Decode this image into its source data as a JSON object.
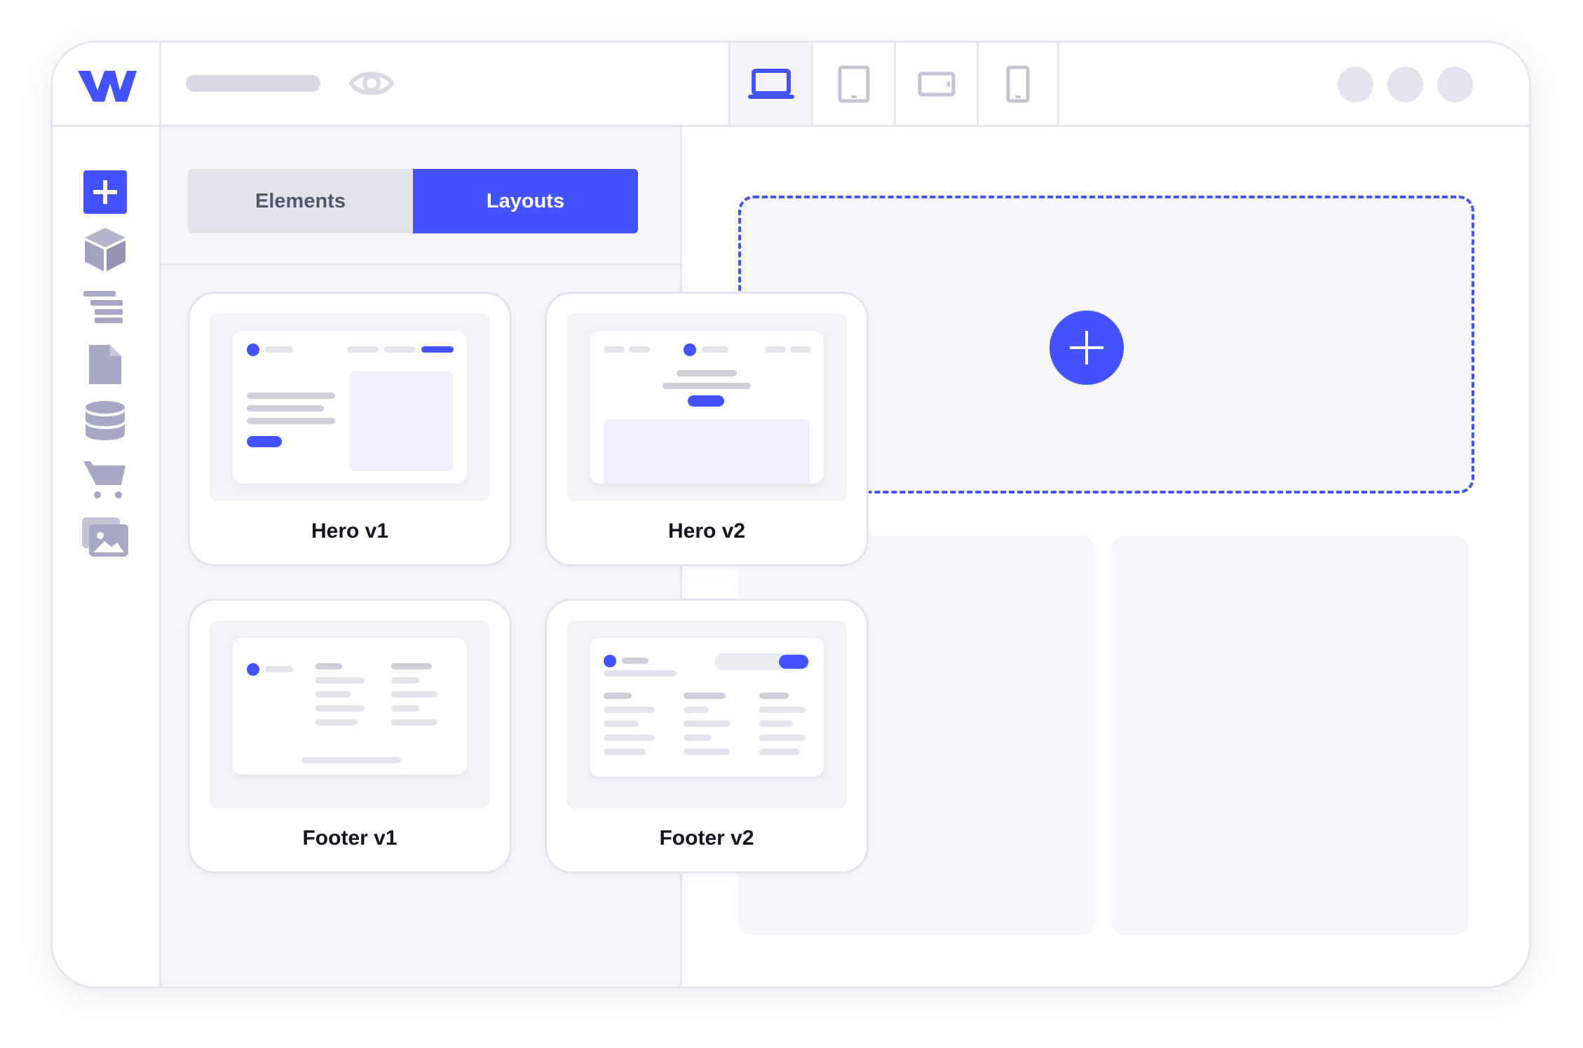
{
  "colors": {
    "accent": "#4353ff",
    "icon_gray": "#a8a8c4",
    "border": "#e6e6ee",
    "panel_bg": "#f6f6fa"
  },
  "topbar": {
    "logo_icon": "webflow-logo",
    "preview_icon": "eye-icon",
    "devices": [
      {
        "icon": "laptop-icon",
        "active": true
      },
      {
        "icon": "tablet-icon",
        "active": false
      },
      {
        "icon": "tablet-landscape-icon",
        "active": false
      },
      {
        "icon": "phone-icon",
        "active": false
      }
    ],
    "avatar_count": 3
  },
  "rail": {
    "items": [
      {
        "icon": "add-icon",
        "active": true
      },
      {
        "icon": "cube-icon",
        "active": false
      },
      {
        "icon": "navigator-icon",
        "active": false
      },
      {
        "icon": "page-icon",
        "active": false
      },
      {
        "icon": "database-icon",
        "active": false
      },
      {
        "icon": "cart-icon",
        "active": false
      },
      {
        "icon": "assets-icon",
        "active": false
      }
    ]
  },
  "panel": {
    "tabs": [
      {
        "label": "Elements",
        "active": false
      },
      {
        "label": "Layouts",
        "active": true
      }
    ],
    "cards": [
      {
        "label": "Hero v1"
      },
      {
        "label": "Hero v2"
      },
      {
        "label": "Footer v1"
      },
      {
        "label": "Footer v2"
      }
    ]
  },
  "canvas": {
    "add_icon": "plus-icon"
  }
}
